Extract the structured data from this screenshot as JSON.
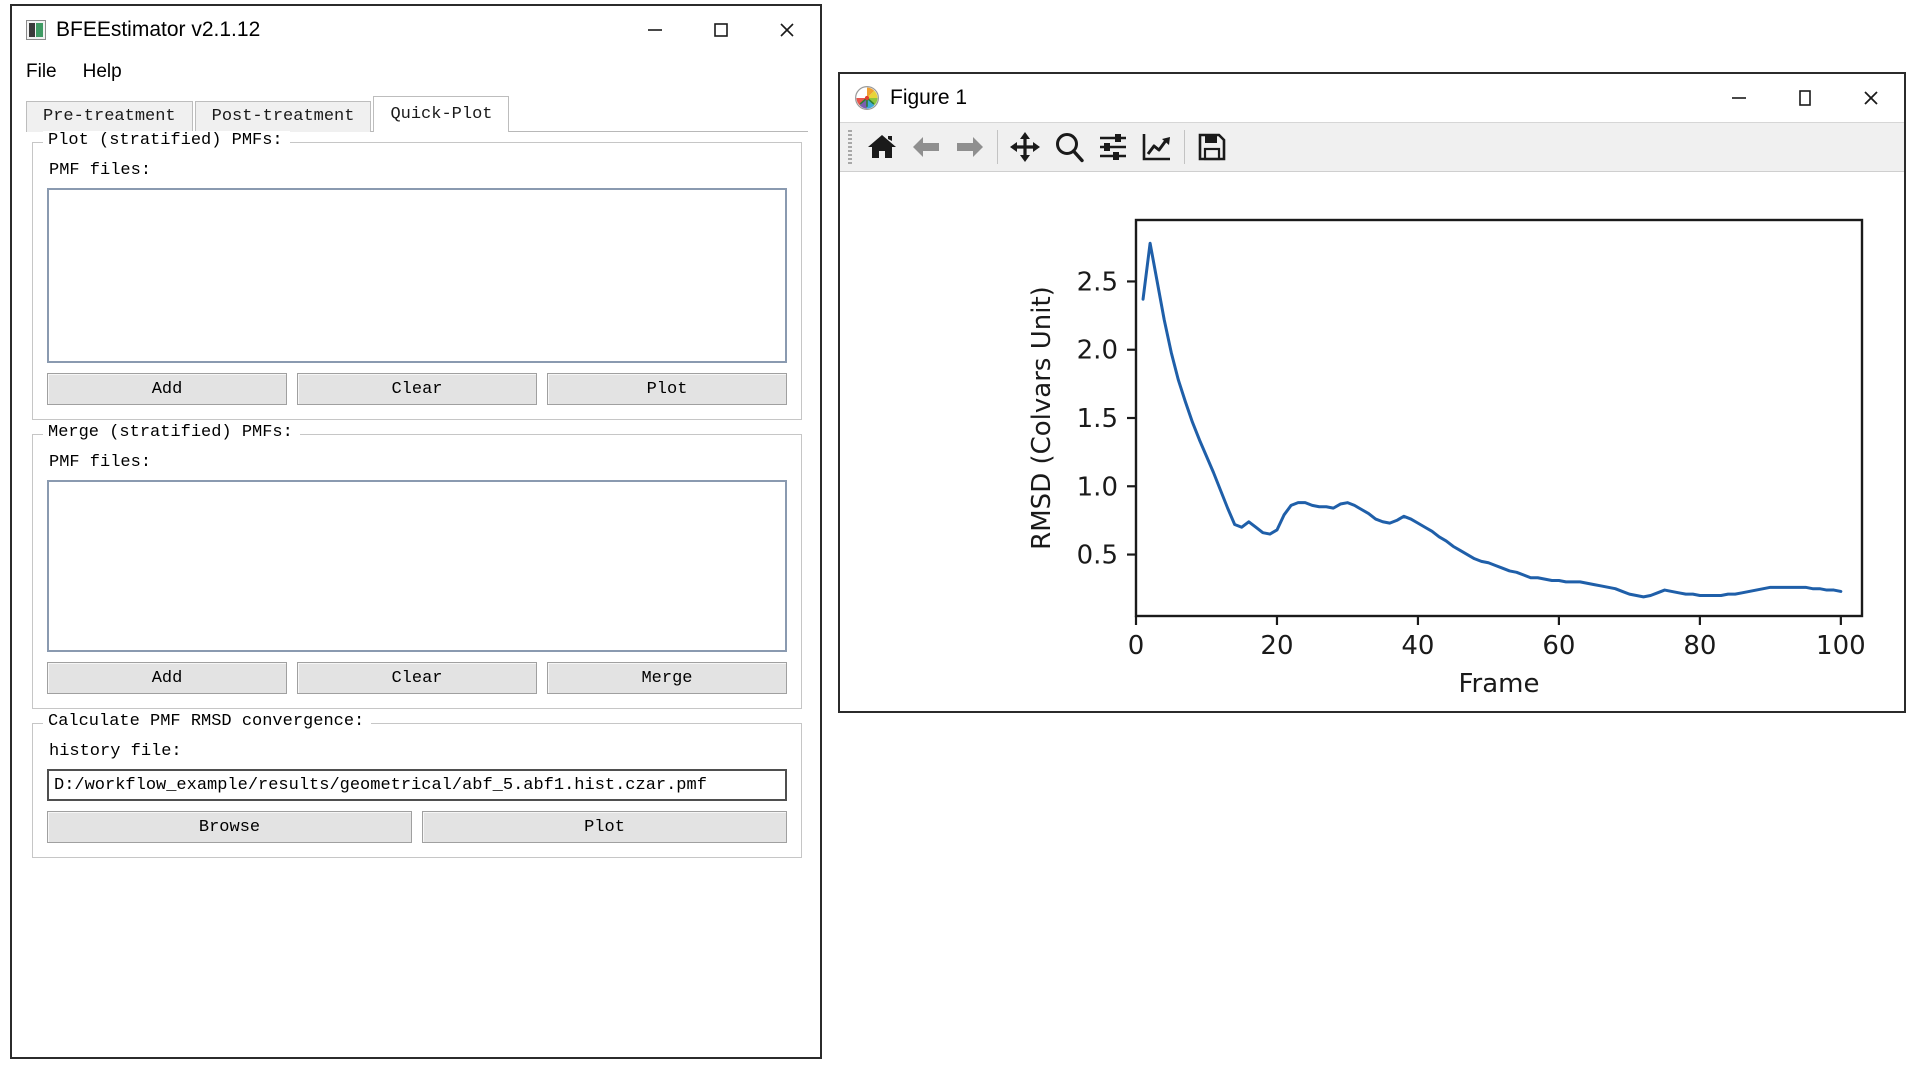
{
  "app_window": {
    "title": "BFEEstimator v2.1.12",
    "icon": "app-icon",
    "window_controls": [
      {
        "name": "minimize",
        "glyph": "minimize-icon"
      },
      {
        "name": "maximize",
        "glyph": "maximize-icon"
      },
      {
        "name": "close",
        "glyph": "close-icon"
      }
    ],
    "menu": [
      {
        "label": "File"
      },
      {
        "label": "Help"
      }
    ],
    "tabs": [
      {
        "label": "Pre-treatment",
        "active": false
      },
      {
        "label": "Post-treatment",
        "active": false
      },
      {
        "label": "Quick-Plot",
        "active": true
      }
    ],
    "groups": [
      {
        "title": "Plot (stratified) PMFs:",
        "field_label": "PMF files:",
        "list_value": "",
        "buttons": [
          "Add",
          "Clear",
          "Plot"
        ]
      },
      {
        "title": "Merge (stratified) PMFs:",
        "field_label": "PMF files:",
        "list_value": "",
        "buttons": [
          "Add",
          "Clear",
          "Merge"
        ]
      }
    ],
    "rmsd_group": {
      "title": "Calculate PMF RMSD convergence:",
      "field_label": "history file:",
      "path_value": "D:/workflow_example/results/geometrical/abf_5.abf1.hist.czar.pmf",
      "buttons": [
        "Browse",
        "Plot"
      ]
    }
  },
  "figure_window": {
    "title": "Figure 1",
    "icon": "matplotlib-logo-icon",
    "window_controls": [
      {
        "name": "minimize",
        "glyph": "minimize-icon"
      },
      {
        "name": "maximize",
        "glyph": "maximize-icon"
      },
      {
        "name": "close",
        "glyph": "close-icon"
      }
    ],
    "toolbar": [
      {
        "name": "home",
        "tip": "Home"
      },
      {
        "name": "back",
        "tip": "Back"
      },
      {
        "name": "forward",
        "tip": "Forward"
      },
      {
        "name": "pan",
        "tip": "Pan"
      },
      {
        "name": "zoom",
        "tip": "Zoom"
      },
      {
        "name": "configure-subplots",
        "tip": "Subplots"
      },
      {
        "name": "edit-axis",
        "tip": "Customize"
      },
      {
        "name": "save",
        "tip": "Save"
      }
    ]
  },
  "chart_data": {
    "type": "line",
    "title": "",
    "xlabel": "Frame",
    "ylabel": "RMSD (Colvars Unit)",
    "xlim": [
      0,
      103
    ],
    "ylim": [
      0.05,
      2.95
    ],
    "xticks": [
      0,
      20,
      40,
      60,
      80,
      100
    ],
    "yticks": [
      0.5,
      1.0,
      1.5,
      2.0,
      2.5
    ],
    "grid": false,
    "legend": null,
    "line_color": "#1f5fa9",
    "line_width": 3,
    "series": [
      {
        "name": "RMSD",
        "x": [
          1,
          2,
          3,
          4,
          5,
          6,
          7,
          8,
          9,
          10,
          11,
          12,
          13,
          14,
          15,
          16,
          17,
          18,
          19,
          20,
          21,
          22,
          23,
          24,
          25,
          26,
          27,
          28,
          29,
          30,
          31,
          32,
          33,
          34,
          35,
          36,
          37,
          38,
          39,
          40,
          41,
          42,
          43,
          44,
          45,
          46,
          47,
          48,
          49,
          50,
          51,
          52,
          53,
          54,
          55,
          56,
          57,
          58,
          59,
          60,
          61,
          62,
          63,
          64,
          65,
          66,
          67,
          68,
          69,
          70,
          71,
          72,
          73,
          74,
          75,
          76,
          77,
          78,
          79,
          80,
          81,
          82,
          83,
          84,
          85,
          86,
          87,
          88,
          89,
          90,
          91,
          92,
          93,
          94,
          95,
          96,
          97,
          98,
          99,
          100
        ],
        "values": [
          2.37,
          2.78,
          2.5,
          2.22,
          1.98,
          1.78,
          1.62,
          1.47,
          1.34,
          1.22,
          1.1,
          0.97,
          0.84,
          0.72,
          0.7,
          0.74,
          0.7,
          0.66,
          0.65,
          0.68,
          0.79,
          0.86,
          0.88,
          0.88,
          0.86,
          0.85,
          0.85,
          0.84,
          0.87,
          0.88,
          0.86,
          0.83,
          0.8,
          0.76,
          0.74,
          0.73,
          0.75,
          0.78,
          0.76,
          0.73,
          0.7,
          0.67,
          0.63,
          0.6,
          0.56,
          0.53,
          0.5,
          0.47,
          0.45,
          0.44,
          0.42,
          0.4,
          0.38,
          0.37,
          0.35,
          0.33,
          0.33,
          0.32,
          0.31,
          0.31,
          0.3,
          0.3,
          0.3,
          0.29,
          0.28,
          0.27,
          0.26,
          0.25,
          0.23,
          0.21,
          0.2,
          0.19,
          0.2,
          0.22,
          0.24,
          0.23,
          0.22,
          0.21,
          0.21,
          0.2,
          0.2,
          0.2,
          0.2,
          0.21,
          0.21,
          0.22,
          0.23,
          0.24,
          0.25,
          0.26,
          0.26,
          0.26,
          0.26,
          0.26,
          0.26,
          0.25,
          0.25,
          0.24,
          0.24,
          0.23
        ]
      }
    ]
  }
}
